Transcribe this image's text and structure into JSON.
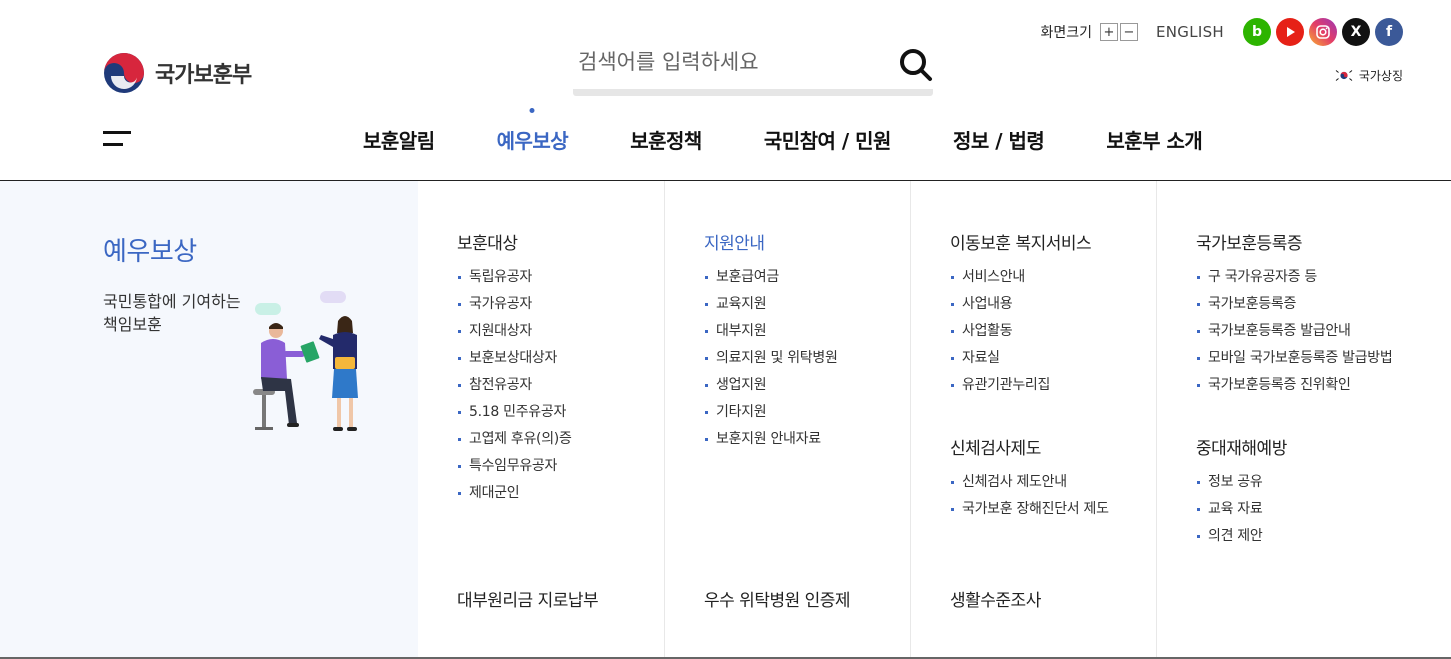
{
  "header": {
    "logo_text": "국가보훈부",
    "search_placeholder": "검색어를 입력하세요",
    "font_size_label": "화면크기",
    "font_plus": "+",
    "font_minus": "−",
    "english": "ENGLISH",
    "sns": {
      "blog": "b",
      "youtube": "youtube-icon",
      "instagram": "instagram-icon",
      "x": "X",
      "facebook": "f"
    },
    "national_symbol": "국가상징"
  },
  "gnb": [
    {
      "label": "보훈알림"
    },
    {
      "label": "예우보상"
    },
    {
      "label": "보훈정책"
    },
    {
      "label": "국민참여 / 민원"
    },
    {
      "label": "정보 / 법령"
    },
    {
      "label": "보훈부 소개"
    }
  ],
  "mega": {
    "intro": {
      "title": "예우보상",
      "desc": "국민통합에 기여하는\n책임보훈"
    },
    "columns": [
      {
        "groups": [
          {
            "title": "보훈대상",
            "items": [
              "독립유공자",
              "국가유공자",
              "지원대상자",
              "보훈보상대상자",
              "참전유공자",
              "5.18 민주유공자",
              "고엽제 후유(의)증",
              "특수임무유공자",
              "제대군인"
            ]
          }
        ],
        "bottom": "대부원리금 지로납부"
      },
      {
        "groups": [
          {
            "title": "지원안내",
            "items": [
              "보훈급여금",
              "교육지원",
              "대부지원",
              "의료지원 및 위탁병원",
              "생업지원",
              "기타지원",
              "보훈지원 안내자료"
            ]
          }
        ],
        "bottom": "우수 위탁병원 인증제"
      },
      {
        "groups": [
          {
            "title": "이동보훈 복지서비스",
            "items": [
              "서비스안내",
              "사업내용",
              "사업활동",
              "자료실",
              "유관기관누리집"
            ]
          },
          {
            "title": "신체검사제도",
            "items": [
              "신체검사 제도안내",
              "국가보훈 장해진단서 제도"
            ]
          }
        ],
        "bottom": "생활수준조사"
      },
      {
        "groups": [
          {
            "title": "국가보훈등록증",
            "items": [
              "구 국가유공자증 등",
              "국가보훈등록증",
              "국가보훈등록증 발급안내",
              "모바일 국가보훈등록증 발급방법",
              "국가보훈등록증 진위확인"
            ]
          },
          {
            "title": "중대재해예방",
            "items": [
              "정보 공유",
              "교육 자료",
              "의견 제안"
            ]
          }
        ],
        "bottom": ""
      }
    ]
  },
  "colors": {
    "accent": "#3b67c3",
    "intro_bg": "#f5f8fd"
  }
}
